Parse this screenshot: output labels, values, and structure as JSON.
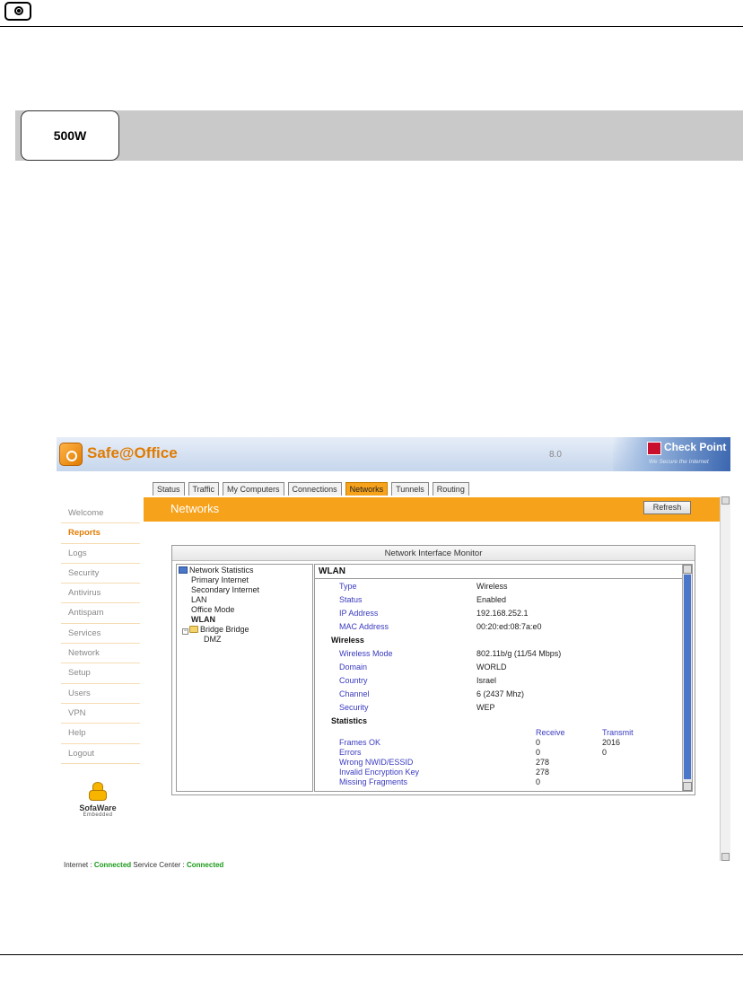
{
  "manual": {
    "model_label": "500W"
  },
  "app": {
    "title": "Safe@Office",
    "version": "8.0",
    "vendor": "Check Point",
    "vendor_tagline": "We Secure the Internet"
  },
  "tabs": [
    {
      "label": "Status",
      "active": false
    },
    {
      "label": "Traffic",
      "active": false
    },
    {
      "label": "My Computers",
      "active": false
    },
    {
      "label": "Connections",
      "active": false
    },
    {
      "label": "Networks",
      "active": true
    },
    {
      "label": "Tunnels",
      "active": false
    },
    {
      "label": "Routing",
      "active": false
    }
  ],
  "nav": [
    {
      "label": "Welcome",
      "active": false
    },
    {
      "label": "Reports",
      "active": true
    },
    {
      "label": "Logs",
      "active": false
    },
    {
      "label": "Security",
      "active": false
    },
    {
      "label": "Antivirus",
      "active": false
    },
    {
      "label": "Antispam",
      "active": false
    },
    {
      "label": "Services",
      "active": false
    },
    {
      "label": "Network",
      "active": false
    },
    {
      "label": "Setup",
      "active": false
    },
    {
      "label": "Users",
      "active": false
    },
    {
      "label": "VPN",
      "active": false
    },
    {
      "label": "Help",
      "active": false
    },
    {
      "label": "Logout",
      "active": false
    }
  ],
  "sofaware": {
    "name": "SofaWare",
    "sub": "Embedded"
  },
  "page": {
    "title": "Networks",
    "refresh_label": "Refresh"
  },
  "monitor": {
    "title": "Network Interface Monitor",
    "tree": {
      "root": "Network Statistics",
      "items": [
        "Primary Internet",
        "Secondary Internet",
        "LAN",
        "Office Mode",
        "WLAN"
      ],
      "bridge": "Bridge Bridge",
      "bridge_child": "DMZ"
    },
    "detail": {
      "heading": "WLAN",
      "general": [
        {
          "key": "Type",
          "value": "Wireless"
        },
        {
          "key": "Status",
          "value": "Enabled"
        },
        {
          "key": "IP Address",
          "value": "192.168.252.1"
        },
        {
          "key": "MAC Address",
          "value": "00:20:ed:08:7a:e0"
        }
      ],
      "wireless_heading": "Wireless",
      "wireless": [
        {
          "key": "Wireless Mode",
          "value": "802.11b/g (11/54 Mbps)"
        },
        {
          "key": "Domain",
          "value": "WORLD"
        },
        {
          "key": "Country",
          "value": "Israel"
        },
        {
          "key": "Channel",
          "value": "6 (2437 Mhz)"
        },
        {
          "key": "Security",
          "value": "WEP"
        }
      ],
      "stats_heading": "Statistics",
      "stats_cols": [
        "Receive",
        "Transmit"
      ],
      "stats": [
        {
          "key": "Frames OK",
          "receive": "0",
          "transmit": "2016"
        },
        {
          "key": "Errors",
          "receive": "0",
          "transmit": "0"
        },
        {
          "key": "Wrong NWID/ESSID",
          "receive": "278",
          "transmit": ""
        },
        {
          "key": "Invalid Encryption Key",
          "receive": "278",
          "transmit": ""
        },
        {
          "key": "Missing Fragments",
          "receive": "0",
          "transmit": ""
        }
      ]
    }
  },
  "status_bar": {
    "internet_label": "Internet :",
    "internet_value": "Connected",
    "service_label": "Service Center :",
    "service_value": "Connected"
  }
}
